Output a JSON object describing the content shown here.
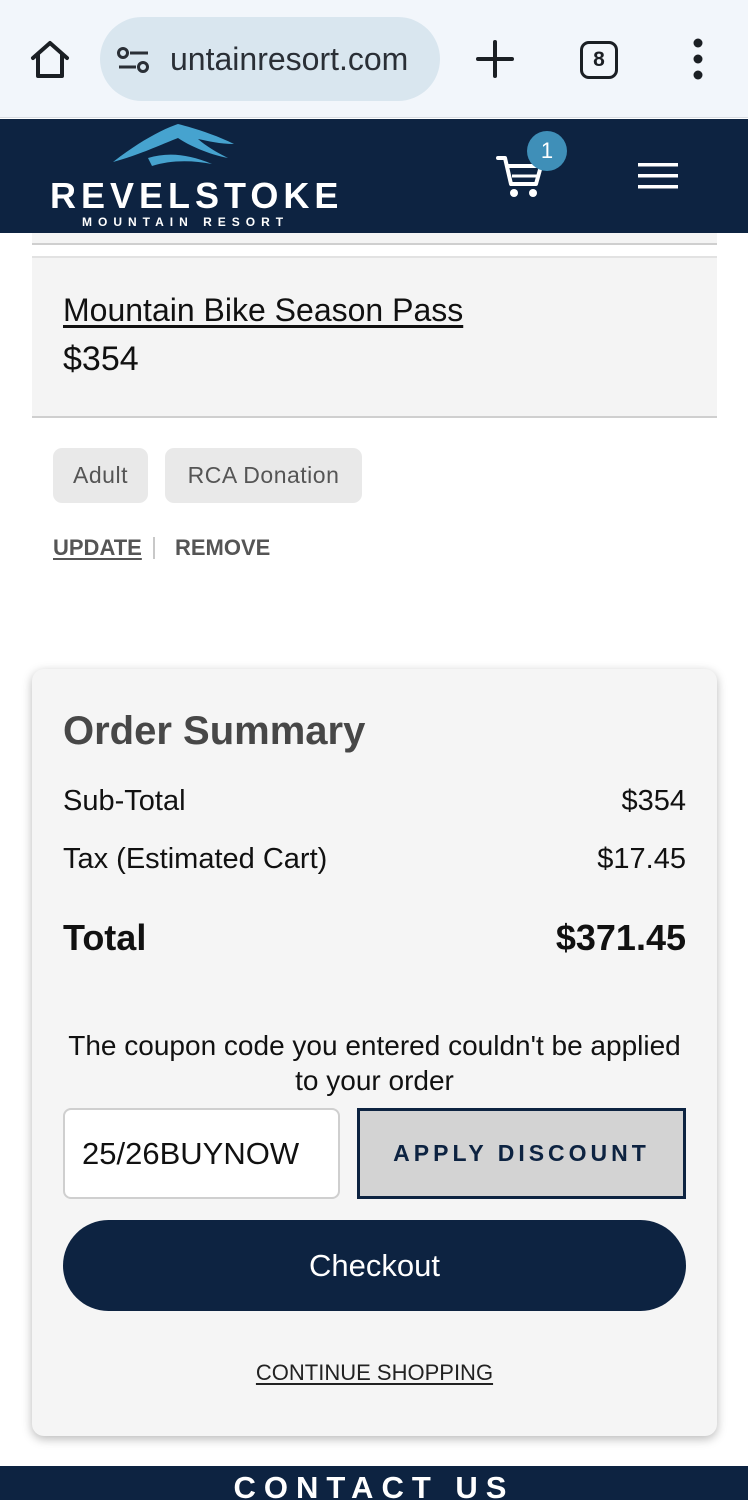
{
  "browser": {
    "url": "untainresort.com",
    "tab_count": "8",
    "icons": [
      "home-icon",
      "site-settings-icon",
      "plus-icon",
      "more-vert-icon"
    ]
  },
  "header": {
    "logo_word": "REVELSTOKE",
    "logo_sub": "MOUNTAIN RESORT",
    "cart_count": "1",
    "brand_color": "#0d2341",
    "accent_color": "#3f8fb8"
  },
  "cart_item": {
    "title": "Mountain Bike Season Pass",
    "price": "$354",
    "options": [
      "Adult",
      "RCA Donation"
    ],
    "update_label": "UPDATE",
    "remove_label": "REMOVE"
  },
  "summary": {
    "title": "Order Summary",
    "rows": [
      {
        "label": "Sub-Total",
        "value": "$354"
      },
      {
        "label": "Tax (Estimated Cart)",
        "value": "$17.45"
      }
    ],
    "total_label": "Total",
    "total_value": "$371.45",
    "coupon_message": "The coupon code you entered couldn't be applied to your order",
    "coupon_value": "25/26BUYNOW",
    "apply_label": "APPLY DISCOUNT",
    "checkout_label": "Checkout",
    "continue_label": "CONTINUE SHOPPING"
  },
  "footer": {
    "contact_label": "CONTACT US"
  }
}
